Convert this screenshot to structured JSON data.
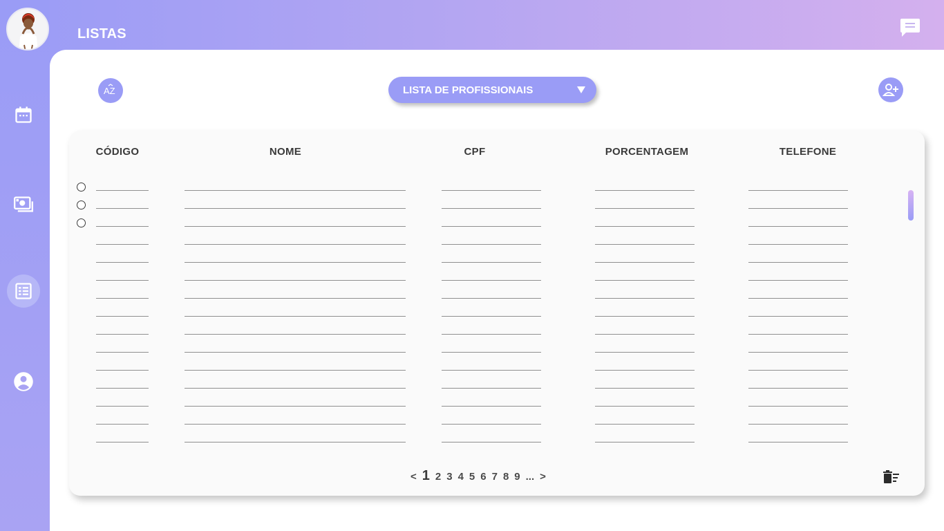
{
  "header": {
    "title": "LISTAS"
  },
  "sidebar": {
    "items": [
      {
        "name": "calendar",
        "icon": "calendar-icon"
      },
      {
        "name": "payments",
        "icon": "money-icon"
      },
      {
        "name": "lists",
        "icon": "list-icon",
        "active": true
      },
      {
        "name": "profile",
        "icon": "account-icon"
      }
    ]
  },
  "toolbar": {
    "sort_icon_label": "AZ",
    "dropdown_label": "LISTA DE PROFISSIONAIS",
    "add_user_icon": "add-user-icon"
  },
  "table": {
    "columns": [
      "CÓDIGO",
      "NOME",
      "CPF",
      "PORCENTAGEM",
      "TELEFONE"
    ],
    "row_count": 15,
    "rows_with_radio": 3
  },
  "pagination": {
    "prev": "<",
    "pages": [
      "1",
      "2",
      "3",
      "4",
      "5",
      "6",
      "7",
      "8",
      "9"
    ],
    "current": "1",
    "ellipsis": "...",
    "next": ">"
  },
  "colors": {
    "accent": "#9a9cf6",
    "gradient_end": "#d4b0ee",
    "active_nav": "#b6b7f7"
  }
}
